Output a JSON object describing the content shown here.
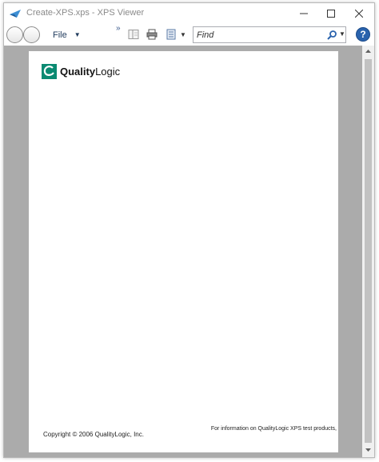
{
  "window": {
    "title": "Create-XPS.xps - XPS Viewer"
  },
  "caption_buttons": {
    "minimize": "minimize-icon",
    "maximize": "maximize-icon",
    "close": "close-icon"
  },
  "toolbar": {
    "file_label": "File",
    "overflow_label": "»",
    "find_placeholder": "Find",
    "help_label": "?"
  },
  "document": {
    "logo_bold": "Quality",
    "logo_regular": "Logic",
    "copyright": "Copyright © 2006 QualityLogic, Inc.",
    "info": "For information on QualityLogic XPS test products,"
  },
  "colors": {
    "background_gray": "#ababab",
    "logo_teal": "#0a8a72",
    "help_blue": "#2a63ad"
  }
}
